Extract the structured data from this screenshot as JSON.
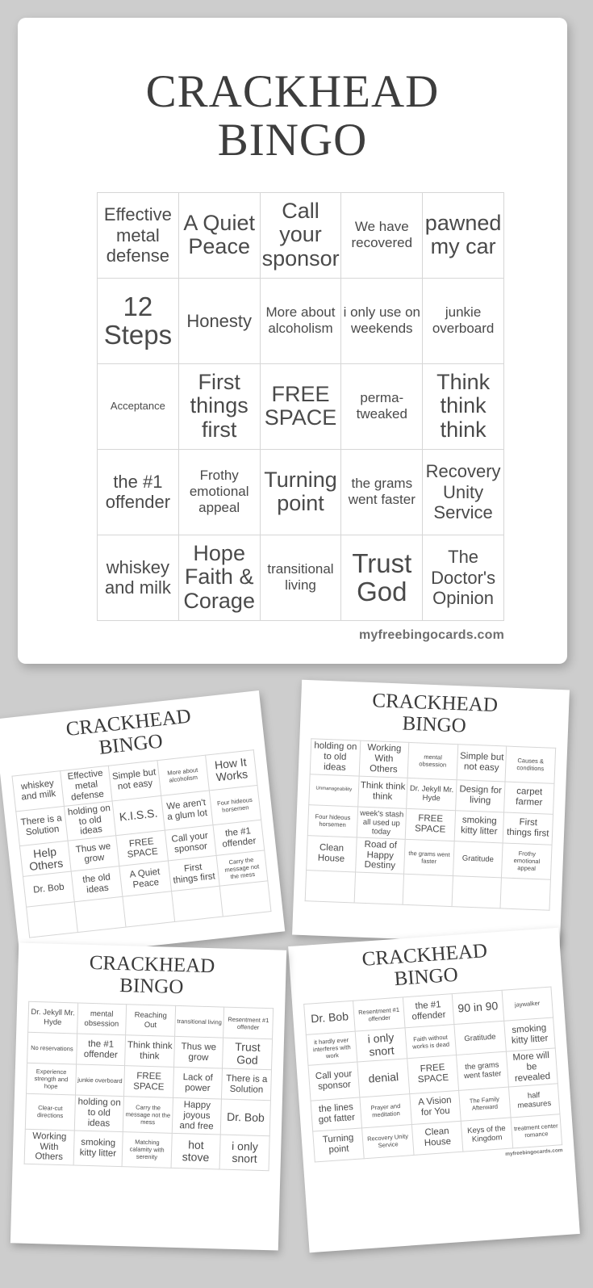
{
  "page": {
    "background_color": "#cdcdcd",
    "card_color": "#ffffff",
    "text_color": "#4a4a4a"
  },
  "hero": {
    "title_line1": "CRACKHEAD",
    "title_line2": "BINGO",
    "footer": "myfreebingocards.com",
    "grid": [
      [
        {
          "text": "Effective metal defense",
          "size": "s2"
        },
        {
          "text": "A Quiet Peace",
          "size": "s1"
        },
        {
          "text": "Call your sponsor",
          "size": "s1"
        },
        {
          "text": "We have recovered",
          "size": "s3"
        },
        {
          "text": "pawned my car",
          "size": "s1"
        }
      ],
      [
        {
          "text": "12 Steps",
          "size": "s5"
        },
        {
          "text": "Honesty",
          "size": "s2"
        },
        {
          "text": "More about alcoholism",
          "size": "s3"
        },
        {
          "text": "i only use on weekends",
          "size": "s3"
        },
        {
          "text": "junkie overboard",
          "size": "s3"
        }
      ],
      [
        {
          "text": "Acceptance",
          "size": "s4"
        },
        {
          "text": "First things first",
          "size": "s1"
        },
        {
          "text": "FREE SPACE",
          "size": "s1"
        },
        {
          "text": "perma-tweaked",
          "size": "s3"
        },
        {
          "text": "Think think think",
          "size": "s1"
        }
      ],
      [
        {
          "text": "the #1 offender",
          "size": "s2"
        },
        {
          "text": "Frothy emotional appeal",
          "size": "s3"
        },
        {
          "text": "Turning point",
          "size": "s1"
        },
        {
          "text": "the grams went faster",
          "size": "s3"
        },
        {
          "text": "Recovery Unity Service",
          "size": "s2"
        }
      ],
      [
        {
          "text": "whiskey and milk",
          "size": "s2"
        },
        {
          "text": "Hope Faith & Corage",
          "size": "s1"
        },
        {
          "text": "transitional living",
          "size": "s3"
        },
        {
          "text": "Trust God",
          "size": "s5"
        },
        {
          "text": "The Doctor's Opinion",
          "size": "s2"
        }
      ]
    ]
  },
  "thumbnails": [
    {
      "title_line1": "CRACKHEAD",
      "title_line2": "BINGO",
      "footer": "",
      "grid": [
        [
          {
            "text": "whiskey and milk",
            "size": "m1"
          },
          {
            "text": "Effective metal defense",
            "size": "m1"
          },
          {
            "text": "Simple but not easy",
            "size": "m1"
          },
          {
            "text": "More about alcoholism",
            "size": "m3"
          },
          {
            "text": "How It Works",
            "size": "m5"
          }
        ],
        [
          {
            "text": "There is a Solution",
            "size": "m1"
          },
          {
            "text": "holding on to old ideas",
            "size": "m1"
          },
          {
            "text": "K.I.S.S.",
            "size": "m5"
          },
          {
            "text": "We aren't a glum lot",
            "size": "m1"
          },
          {
            "text": "Four hideous horsemen",
            "size": "m3"
          }
        ],
        [
          {
            "text": "Help Others",
            "size": "m5"
          },
          {
            "text": "Thus we grow",
            "size": "m1"
          },
          {
            "text": "FREE SPACE",
            "size": "m1"
          },
          {
            "text": "Call your sponsor",
            "size": "m1"
          },
          {
            "text": "the #1 offender",
            "size": "m1"
          }
        ],
        [
          {
            "text": "Dr. Bob",
            "size": "m1"
          },
          {
            "text": "the old ideas",
            "size": "m1"
          },
          {
            "text": "A Quiet Peace",
            "size": "m1"
          },
          {
            "text": "First things first",
            "size": "m1"
          },
          {
            "text": "Carry the message not the mess",
            "size": "m3"
          }
        ],
        [
          {
            "text": "",
            "size": "m3"
          },
          {
            "text": "",
            "size": "m3"
          },
          {
            "text": "",
            "size": "m3"
          },
          {
            "text": "",
            "size": "m3"
          },
          {
            "text": "",
            "size": "m3"
          }
        ]
      ]
    },
    {
      "title_line1": "CRACKHEAD",
      "title_line2": "BINGO",
      "footer": "",
      "grid": [
        [
          {
            "text": "holding on to old ideas",
            "size": "m1"
          },
          {
            "text": "Working With Others",
            "size": "m1"
          },
          {
            "text": "mental obsession",
            "size": "m3"
          },
          {
            "text": "Simple but not easy",
            "size": "m1"
          },
          {
            "text": "Causes & conditions",
            "size": "m3"
          }
        ],
        [
          {
            "text": "Unmanageability",
            "size": "m4"
          },
          {
            "text": "Think think think",
            "size": "m1"
          },
          {
            "text": "Dr. Jekyll Mr. Hyde",
            "size": "m2"
          },
          {
            "text": "Design for living",
            "size": "m1"
          },
          {
            "text": "carpet farmer",
            "size": "m1"
          }
        ],
        [
          {
            "text": "Four hideous horsemen",
            "size": "m3"
          },
          {
            "text": "week's stash all used up today",
            "size": "m2"
          },
          {
            "text": "FREE SPACE",
            "size": "m1"
          },
          {
            "text": "smoking kitty litter",
            "size": "m1"
          },
          {
            "text": "First things first",
            "size": "m1"
          }
        ],
        [
          {
            "text": "Clean House",
            "size": "m1"
          },
          {
            "text": "Road of Happy Destiny",
            "size": "m1"
          },
          {
            "text": "the grams went faster",
            "size": "m3"
          },
          {
            "text": "Gratitude",
            "size": "m2"
          },
          {
            "text": "Frothy emotional appeal",
            "size": "m3"
          }
        ],
        [
          {
            "text": "",
            "size": "m3"
          },
          {
            "text": "",
            "size": "m3"
          },
          {
            "text": "",
            "size": "m3"
          },
          {
            "text": "",
            "size": "m3"
          },
          {
            "text": "",
            "size": "m3"
          }
        ]
      ]
    },
    {
      "title_line1": "CRACKHEAD",
      "title_line2": "BINGO",
      "footer": "",
      "grid": [
        [
          {
            "text": "Dr. Jekyll Mr. Hyde",
            "size": "m2"
          },
          {
            "text": "mental obsession",
            "size": "m2"
          },
          {
            "text": "Reaching Out",
            "size": "m2"
          },
          {
            "text": "transitional living",
            "size": "m3"
          },
          {
            "text": "Resentment #1 offender",
            "size": "m3"
          }
        ],
        [
          {
            "text": "No reservations",
            "size": "m3"
          },
          {
            "text": "the #1 offender",
            "size": "m1"
          },
          {
            "text": "Think think think",
            "size": "m1"
          },
          {
            "text": "Thus we grow",
            "size": "m1"
          },
          {
            "text": "Trust God",
            "size": "m5"
          }
        ],
        [
          {
            "text": "Experience strength and hope",
            "size": "m3"
          },
          {
            "text": "junkie overboard",
            "size": "m3"
          },
          {
            "text": "FREE SPACE",
            "size": "m1"
          },
          {
            "text": "Lack of power",
            "size": "m1"
          },
          {
            "text": "There is a Solution",
            "size": "m1"
          }
        ],
        [
          {
            "text": "Clear-cut directions",
            "size": "m3"
          },
          {
            "text": "holding on to old ideas",
            "size": "m1"
          },
          {
            "text": "Carry the message not the mess",
            "size": "m3"
          },
          {
            "text": "Happy joyous and free",
            "size": "m1"
          },
          {
            "text": "Dr. Bob",
            "size": "m5"
          }
        ],
        [
          {
            "text": "Working With Others",
            "size": "m1"
          },
          {
            "text": "smoking kitty litter",
            "size": "m1"
          },
          {
            "text": "Matching calamity with serenity",
            "size": "m3"
          },
          {
            "text": "hot stove",
            "size": "m5"
          },
          {
            "text": "i only snort",
            "size": "m5"
          }
        ]
      ]
    },
    {
      "title_line1": "CRACKHEAD",
      "title_line2": "BINGO",
      "footer": "myfreebingocards.com",
      "grid": [
        [
          {
            "text": "Dr. Bob",
            "size": "m5"
          },
          {
            "text": "Resentment #1 offender",
            "size": "m3"
          },
          {
            "text": "the #1 offender",
            "size": "m1"
          },
          {
            "text": "90 in 90",
            "size": "m5"
          },
          {
            "text": "jaywalker",
            "size": "m3"
          }
        ],
        [
          {
            "text": "it hardly ever interferes with work",
            "size": "m3"
          },
          {
            "text": "i only snort",
            "size": "m5"
          },
          {
            "text": "Faith without works is dead",
            "size": "m3"
          },
          {
            "text": "Gratitude",
            "size": "m2"
          },
          {
            "text": "smoking kitty litter",
            "size": "m1"
          }
        ],
        [
          {
            "text": "Call your sponsor",
            "size": "m1"
          },
          {
            "text": "denial",
            "size": "m5"
          },
          {
            "text": "FREE SPACE",
            "size": "m1"
          },
          {
            "text": "the grams went faster",
            "size": "m2"
          },
          {
            "text": "More will be revealed",
            "size": "m1"
          }
        ],
        [
          {
            "text": "the lines got fatter",
            "size": "m1"
          },
          {
            "text": "Prayer and meditation",
            "size": "m3"
          },
          {
            "text": "A Vision for You",
            "size": "m1"
          },
          {
            "text": "The Family Afterward",
            "size": "m3"
          },
          {
            "text": "half measures",
            "size": "m2"
          }
        ],
        [
          {
            "text": "Turning point",
            "size": "m1"
          },
          {
            "text": "Recovery Unity Service",
            "size": "m3"
          },
          {
            "text": "Clean House",
            "size": "m1"
          },
          {
            "text": "Keys of the Kingdom",
            "size": "m2"
          },
          {
            "text": "treatment center romance",
            "size": "m3"
          }
        ]
      ]
    }
  ]
}
